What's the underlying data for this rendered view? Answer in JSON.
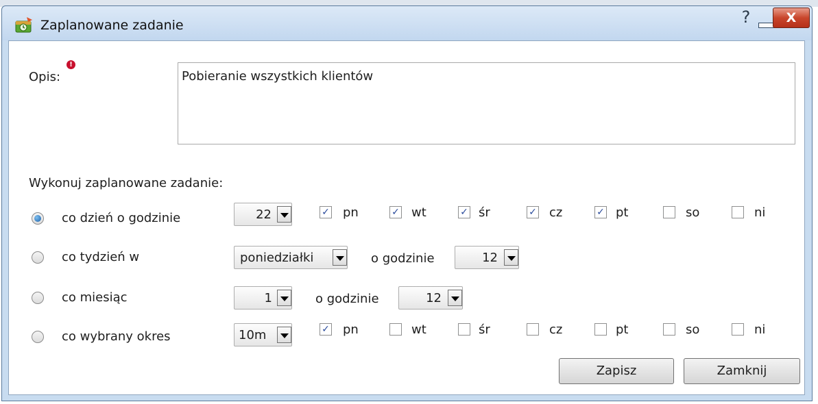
{
  "window": {
    "title": "Zaplanowane zadanie",
    "help": "?",
    "close": "X"
  },
  "form": {
    "desc_label": "Opis:",
    "required_mark": "!",
    "desc_value": "Pobieranie wszystkich klientów",
    "schedule_label": "Wykonuj zaplanowane zadanie:",
    "at_hour_label": "o godzinie",
    "days": [
      "pn",
      "wt",
      "śr",
      "cz",
      "pt",
      "so",
      "ni"
    ],
    "daily": {
      "label": "co dzień o godzinie",
      "selected": true,
      "hour": "22",
      "days_checked": [
        true,
        true,
        true,
        true,
        true,
        false,
        false
      ]
    },
    "weekly": {
      "label": "co tydzień w",
      "selected": false,
      "day": "poniedziałki",
      "hour": "12"
    },
    "monthly": {
      "label": "co miesiąc",
      "selected": false,
      "day": "1",
      "hour": "12"
    },
    "period": {
      "label": "co wybrany okres",
      "selected": false,
      "interval": "10m",
      "days_checked": [
        true,
        false,
        false,
        false,
        false,
        false,
        false
      ]
    }
  },
  "buttons": {
    "save": "Zapisz",
    "close": "Zamknij"
  },
  "icons": {
    "app": "scheduled-task-icon",
    "check_mark": "✓"
  }
}
